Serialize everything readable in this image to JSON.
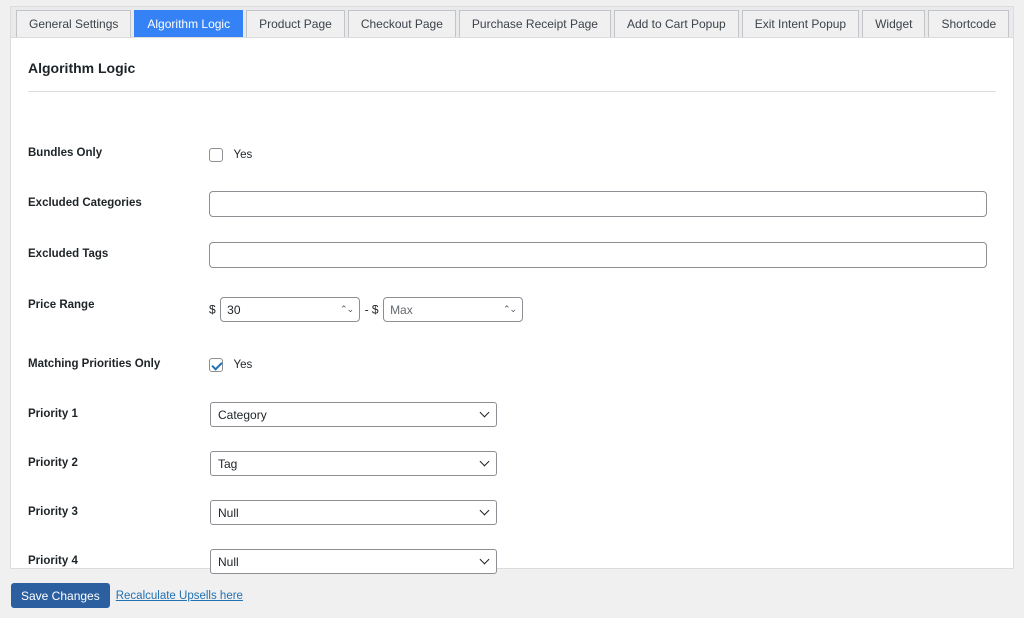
{
  "tabs": [
    {
      "label": "General Settings"
    },
    {
      "label": "Algorithm Logic"
    },
    {
      "label": "Product Page"
    },
    {
      "label": "Checkout Page"
    },
    {
      "label": "Purchase Receipt Page"
    },
    {
      "label": "Add to Cart Popup"
    },
    {
      "label": "Exit Intent Popup"
    },
    {
      "label": "Widget"
    },
    {
      "label": "Shortcode"
    }
  ],
  "active_tab": "Algorithm Logic",
  "panel": {
    "title": "Algorithm Logic",
    "bundles_only": {
      "label": "Bundles Only",
      "option": "Yes",
      "checked": false
    },
    "excluded_categories": {
      "label": "Excluded Categories",
      "value": ""
    },
    "excluded_tags": {
      "label": "Excluded Tags",
      "value": ""
    },
    "price_range": {
      "label": "Price Range",
      "currency": "$",
      "separator": "- $",
      "min_value": "30",
      "max_placeholder": "Max"
    },
    "matching_priorities_only": {
      "label": "Matching Priorities Only",
      "option": "Yes",
      "checked": true
    },
    "priorities": [
      {
        "label": "Priority 1",
        "value": "Category"
      },
      {
        "label": "Priority 2",
        "value": "Tag"
      },
      {
        "label": "Priority 3",
        "value": "Null"
      },
      {
        "label": "Priority 4",
        "value": "Null"
      }
    ]
  },
  "footer": {
    "save_label": "Save Changes",
    "recalc_link": "Recalculate Upsells here"
  },
  "colors": {
    "accent": "#3582f6",
    "button": "#2c5fa0",
    "link": "#2271b1"
  }
}
